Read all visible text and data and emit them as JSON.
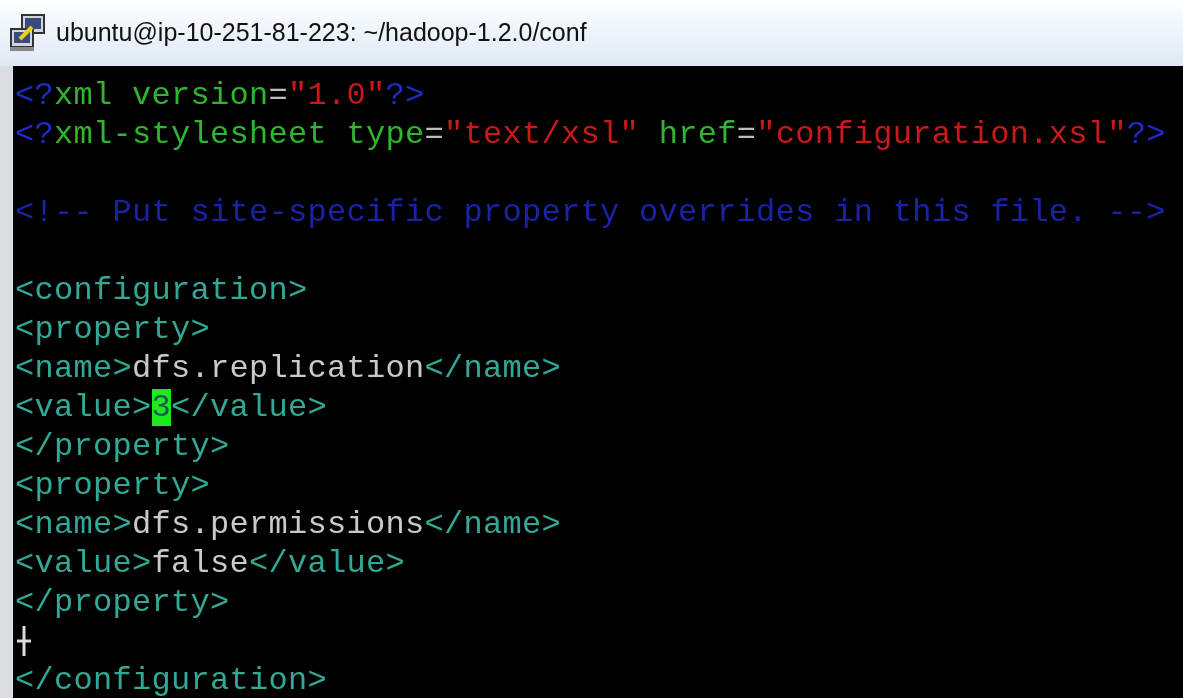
{
  "window": {
    "title": "ubuntu@ip-10-251-81-223: ~/hadoop-1.2.0/conf"
  },
  "lines": [
    {
      "kind": "code",
      "tokens": [
        {
          "text": "<?",
          "kind": "pi"
        },
        {
          "text": "xml version",
          "kind": "attr"
        },
        {
          "text": "=",
          "kind": "punct"
        },
        {
          "text": "\"1.0\"",
          "kind": "string"
        },
        {
          "text": "?>",
          "kind": "pi"
        }
      ]
    },
    {
      "kind": "code",
      "tokens": [
        {
          "text": "<?",
          "kind": "pi"
        },
        {
          "text": "xml-stylesheet type",
          "kind": "attr"
        },
        {
          "text": "=",
          "kind": "punct"
        },
        {
          "text": "\"text/xsl\"",
          "kind": "string"
        },
        {
          "text": " href",
          "kind": "attr"
        },
        {
          "text": "=",
          "kind": "punct"
        },
        {
          "text": "\"configuration.xsl\"",
          "kind": "string"
        },
        {
          "text": "?>",
          "kind": "pi"
        }
      ]
    },
    {
      "kind": "blank"
    },
    {
      "kind": "code",
      "tokens": [
        {
          "text": "<!-- Put site-specific property overrides in this file. -->",
          "kind": "comment"
        }
      ]
    },
    {
      "kind": "blank"
    },
    {
      "kind": "code",
      "tokens": [
        {
          "text": "<configuration>",
          "kind": "tag"
        }
      ]
    },
    {
      "kind": "code",
      "tokens": [
        {
          "text": "<property>",
          "kind": "tag"
        }
      ]
    },
    {
      "kind": "code",
      "tokens": [
        {
          "text": "<name>",
          "kind": "tag"
        },
        {
          "text": "dfs.replication",
          "kind": "text"
        },
        {
          "text": "</name>",
          "kind": "tag"
        }
      ]
    },
    {
      "kind": "code",
      "tokens": [
        {
          "text": "<value>",
          "kind": "tag"
        },
        {
          "text": "3",
          "kind": "cursor"
        },
        {
          "text": "</value>",
          "kind": "tag"
        }
      ]
    },
    {
      "kind": "code",
      "tokens": [
        {
          "text": "</property>",
          "kind": "tag"
        }
      ]
    },
    {
      "kind": "code",
      "tokens": [
        {
          "text": "<property>",
          "kind": "tag"
        }
      ]
    },
    {
      "kind": "code",
      "tokens": [
        {
          "text": "<name>",
          "kind": "tag"
        },
        {
          "text": "dfs.permissions",
          "kind": "text"
        },
        {
          "text": "</name>",
          "kind": "tag"
        }
      ]
    },
    {
      "kind": "code",
      "tokens": [
        {
          "text": "<value>",
          "kind": "tag"
        },
        {
          "text": "false",
          "kind": "text"
        },
        {
          "text": "</value>",
          "kind": "tag"
        }
      ]
    },
    {
      "kind": "code",
      "tokens": [
        {
          "text": "</property>",
          "kind": "tag"
        }
      ]
    },
    {
      "kind": "pointer"
    },
    {
      "kind": "code",
      "tokens": [
        {
          "text": "</configuration>",
          "kind": "tag"
        }
      ]
    }
  ]
}
